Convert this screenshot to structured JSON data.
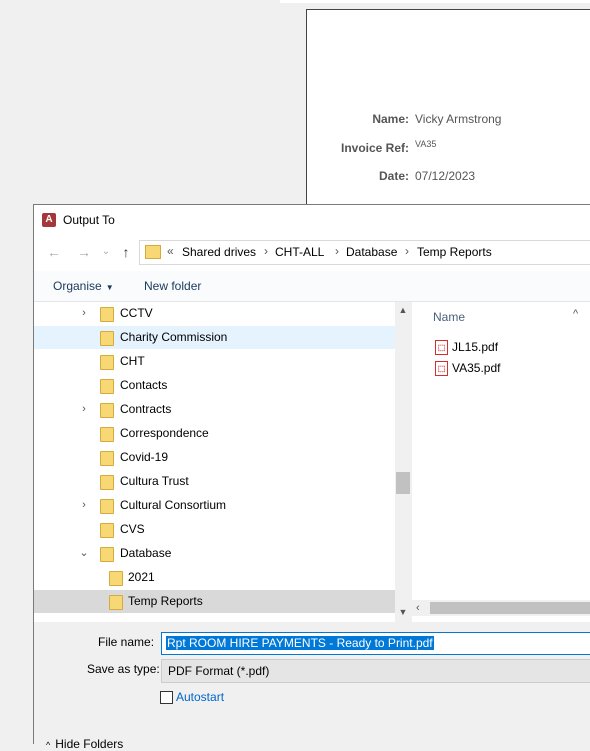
{
  "report": {
    "fields": [
      {
        "label": "Name:",
        "value": "Vicky Armstrong"
      },
      {
        "label": "Invoice Ref:",
        "value": "VA35"
      },
      {
        "label": "Date:",
        "value": "07/12/2023"
      }
    ]
  },
  "dialog": {
    "title": "Output To",
    "app_icon": "A"
  },
  "nav": {
    "back_icon": "←",
    "forward_icon": "→",
    "recent_icon": "⌄",
    "up_icon": "↑"
  },
  "address": {
    "overflow": "«",
    "separator": "›",
    "crumbs": [
      "Shared drives",
      "CHT-ALL",
      "Database",
      "Temp Reports"
    ]
  },
  "toolbar": {
    "organise_label": "Organise",
    "organise_caret": "▼",
    "new_folder_label": "New folder"
  },
  "tree": {
    "items": [
      {
        "label": "CCTV",
        "expander": "›"
      },
      {
        "label": "Charity Commission",
        "expander": ""
      },
      {
        "label": "CHT",
        "expander": ""
      },
      {
        "label": "Contacts",
        "expander": ""
      },
      {
        "label": "Contracts",
        "expander": "›"
      },
      {
        "label": "Correspondence",
        "expander": ""
      },
      {
        "label": "Covid-19",
        "expander": ""
      },
      {
        "label": "Cultura Trust",
        "expander": ""
      },
      {
        "label": "Cultural Consortium",
        "expander": "›"
      },
      {
        "label": "CVS",
        "expander": ""
      },
      {
        "label": "Database",
        "expander": "⌄"
      },
      {
        "label": "2021",
        "expander": ""
      },
      {
        "label": "Temp Reports",
        "expander": ""
      }
    ],
    "scroll_up": "▲",
    "scroll_down": "▼"
  },
  "files": {
    "column_header": "Name",
    "sort_indicator": "^",
    "items": [
      "JL15.pdf",
      "VA35.pdf"
    ],
    "scroll_left": "‹"
  },
  "save": {
    "filename_label": "File name:",
    "filename_value": "Rpt ROOM HIRE PAYMENTS - Ready to Print.pdf",
    "savetype_label": "Save as type:",
    "savetype_value": "PDF Format (*.pdf)",
    "autostart_label": "Autostart",
    "hide_folders_label": "Hide Folders",
    "hide_folders_icon": "^"
  },
  "colors": {
    "selection_blue": "#0078d7",
    "folder_yellow": "#f8d775",
    "pdf_red": "#d0312d",
    "access_red": "#a4373a"
  }
}
